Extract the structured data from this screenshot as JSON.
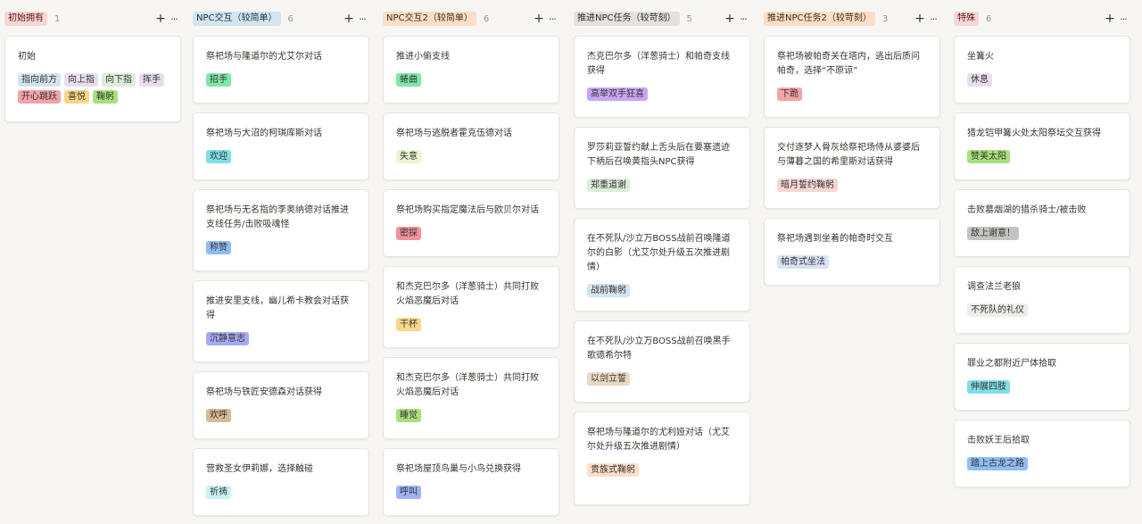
{
  "columns": [
    {
      "title": "初始拥有",
      "count": "1",
      "title_bg": "#f7d6d6",
      "title_color": "#5d1715",
      "cards": [
        {
          "title": "初始",
          "tags": [
            {
              "label": "指向前方",
              "bg": "#d3e5ef"
            },
            {
              "label": "向上指",
              "bg": "#e8deee"
            },
            {
              "label": "向下指",
              "bg": "#dbeddb"
            },
            {
              "label": "挥手",
              "bg": "#e8deee"
            },
            {
              "label": "开心跳跃",
              "bg": "#f4a3a8"
            },
            {
              "label": "喜悦",
              "bg": "#fad68b"
            },
            {
              "label": "鞠躬",
              "bg": "#a9e07e"
            }
          ]
        }
      ]
    },
    {
      "title": "NPC交互（较简单）",
      "count": "6",
      "title_bg": "#d3e5ef",
      "title_color": "#183347",
      "cards": [
        {
          "title": "祭祀场与隆道尔的尤艾尔对话",
          "tags": [
            {
              "label": "招手",
              "bg": "#7ee8a8"
            }
          ]
        },
        {
          "title": "祭祀场与大沼的柯琪库斯对话",
          "tags": [
            {
              "label": "欢迎",
              "bg": "#7fdfe6"
            }
          ]
        },
        {
          "title": "祭祀场与无名指的李奥纳德对话推进支线任务/击败吸魂怪",
          "tags": [
            {
              "label": "称赞",
              "bg": "#8fbdf5"
            }
          ]
        },
        {
          "title": "推进安里支线，幽儿希卡教会对话获得",
          "tags": [
            {
              "label": "沉静意志",
              "bg": "#a7a9f5"
            }
          ]
        },
        {
          "title": "祭祀场与铁匠安德森对话获得",
          "tags": [
            {
              "label": "欢呼",
              "bg": "#d8bb96"
            }
          ]
        },
        {
          "title": "营救圣女伊莉娜，选择触碰",
          "tags": [
            {
              "label": "祈祷",
              "bg": "#c8f3f3"
            }
          ]
        }
      ]
    },
    {
      "title": "NPC交互2（较简单）",
      "count": "6",
      "title_bg": "#fadec9",
      "title_color": "#49290e",
      "cards": [
        {
          "title": "推进小偷支线",
          "tags": [
            {
              "label": "蜷曲",
              "bg": "#7ee8a8"
            }
          ]
        },
        {
          "title": "祭祀场与逃脱者霍克伍德对话",
          "tags": [
            {
              "label": "失意",
              "bg": "#e9f6d0"
            }
          ]
        },
        {
          "title": "祭祀场购买指定魔法后与欧贝尔对话",
          "tags": [
            {
              "label": "密探",
              "bg": "#f2929c"
            }
          ]
        },
        {
          "title": "和杰克巴尔多（洋葱骑士）共同打败火焰恶魔后对话",
          "tags": [
            {
              "label": "干杯",
              "bg": "#fad68b"
            }
          ]
        },
        {
          "title": "和杰克巴尔多（洋葱骑士）共同打败火焰恶魔后对话",
          "tags": [
            {
              "label": "睡觉",
              "bg": "#a9e07e"
            }
          ]
        },
        {
          "title": "祭祀场屋顶鸟巢与小鸟兑换获得",
          "tags": [
            {
              "label": "呼叫",
              "bg": "#9eb3f7"
            }
          ]
        }
      ]
    },
    {
      "title": "推进NPC任务（较苛刻）",
      "count": "5",
      "title_bg": "#e3e2e0",
      "title_color": "#32302c",
      "cards": [
        {
          "title": "杰克巴尔多（洋葱骑士）和帕奇支线获得",
          "tags": [
            {
              "label": "高举双手狂喜",
              "bg": "#c6a6f5"
            }
          ]
        },
        {
          "title": "罗莎莉亚誓约献上舌头后在要塞遗迹下柄后召唤黄指头NPC获得",
          "tags": [
            {
              "label": "郑重道谢",
              "bg": "#dbeddb"
            }
          ]
        },
        {
          "title": "在不死队/沙立万BOSS战前召唤隆道尔的白影（尤艾尔处升级五次推进剧情）",
          "tags": [
            {
              "label": "战前鞠躬",
              "bg": "#d3e5ef"
            }
          ]
        },
        {
          "title": "在不死队/沙立万BOSS战前召唤黑手歌德希尔特",
          "tags": [
            {
              "label": "以剑立誓",
              "bg": "#ead8c6"
            }
          ]
        },
        {
          "title": "祭祀场与隆道尔的尤利娅对话（尤艾尔处升级五次推进剧情）",
          "tags": [
            {
              "label": "贵族式鞠躬",
              "bg": "#fadec9"
            }
          ]
        }
      ]
    },
    {
      "title": "推进NPC任务2（较苛刻）",
      "count": "3",
      "title_bg": "#fadec9",
      "title_color": "#49290e",
      "cards": [
        {
          "title": "祭祀场被帕奇关在塔内，逃出后质问帕奇，选择“不原谅”",
          "tags": [
            {
              "label": "下跪",
              "bg": "#f4a3a8"
            }
          ]
        },
        {
          "title": "交付逐梦人骨灰给祭祀场侍从婆婆后与薄暮之国的希里斯对话获得",
          "tags": [
            {
              "label": "暗月誓约鞠躬",
              "bg": "#f7d6d6"
            }
          ]
        },
        {
          "title": "祭祀场遇到坐着的帕奇时交互",
          "tags": [
            {
              "label": "帕奇式坐法",
              "bg": "#d8e2f6"
            }
          ]
        }
      ]
    },
    {
      "title": "特殊",
      "count": "6",
      "title_bg": "#f7d6d6",
      "title_color": "#5d1715",
      "cards": [
        {
          "title": "坐篝火",
          "tags": [
            {
              "label": "休息",
              "bg": "#e8deee"
            }
          ]
        },
        {
          "title": "猎龙铠甲篝火处太阳祭坛交互获得",
          "tags": [
            {
              "label": "赞美太阳",
              "bg": "#a9e07e"
            }
          ]
        },
        {
          "title": "击败墓烟湖的猎杀骑士/被击败",
          "tags": [
            {
              "label": "敌上谢意！",
              "bg": "#c4c3c1"
            }
          ]
        },
        {
          "title": "调查法兰老狼",
          "tags": [
            {
              "label": "不死队的礼仪",
              "bg": "#ededeb"
            }
          ]
        },
        {
          "title": "罪业之都附近尸体拾取",
          "tags": [
            {
              "label": "伸展四肢",
              "bg": "#7fdfe6"
            }
          ]
        },
        {
          "title": "击败妖王后拾取",
          "tags": [
            {
              "label": "踏上古龙之路",
              "bg": "#8fbdf5"
            }
          ]
        }
      ]
    }
  ]
}
